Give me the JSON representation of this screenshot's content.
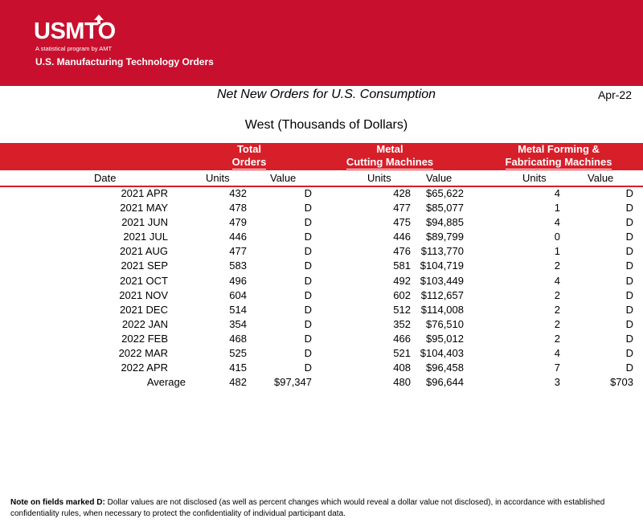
{
  "header": {
    "logo_text": "USMTO",
    "logo_subtitle": "A statistical program by AMT",
    "banner_title": "U.S. Manufacturing Technology Orders"
  },
  "title": "Net New Orders for U.S. Consumption",
  "period": "Apr-22",
  "subtitle": "West (Thousands of Dollars)",
  "groups": {
    "total": [
      "Total",
      "Orders"
    ],
    "metal_cutting": [
      "Metal",
      "Cutting Machines"
    ],
    "metal_forming": [
      "Metal Forming &",
      "Fabricating Machines"
    ]
  },
  "columns": {
    "date": "Date",
    "units": "Units",
    "value": "Value"
  },
  "rows": [
    {
      "date": "2021 APR",
      "total_units": "432",
      "total_value": "D",
      "mc_units": "428",
      "mc_value": "$65,622",
      "mf_units": "4",
      "mf_value": "D"
    },
    {
      "date": "2021 MAY",
      "total_units": "478",
      "total_value": "D",
      "mc_units": "477",
      "mc_value": "$85,077",
      "mf_units": "1",
      "mf_value": "D"
    },
    {
      "date": "2021 JUN",
      "total_units": "479",
      "total_value": "D",
      "mc_units": "475",
      "mc_value": "$94,885",
      "mf_units": "4",
      "mf_value": "D"
    },
    {
      "date": "2021 JUL",
      "total_units": "446",
      "total_value": "D",
      "mc_units": "446",
      "mc_value": "$89,799",
      "mf_units": "0",
      "mf_value": "D"
    },
    {
      "date": "2021 AUG",
      "total_units": "477",
      "total_value": "D",
      "mc_units": "476",
      "mc_value": "$113,770",
      "mf_units": "1",
      "mf_value": "D"
    },
    {
      "date": "2021 SEP",
      "total_units": "583",
      "total_value": "D",
      "mc_units": "581",
      "mc_value": "$104,719",
      "mf_units": "2",
      "mf_value": "D"
    },
    {
      "date": "2021 OCT",
      "total_units": "496",
      "total_value": "D",
      "mc_units": "492",
      "mc_value": "$103,449",
      "mf_units": "4",
      "mf_value": "D"
    },
    {
      "date": "2021 NOV",
      "total_units": "604",
      "total_value": "D",
      "mc_units": "602",
      "mc_value": "$112,657",
      "mf_units": "2",
      "mf_value": "D"
    },
    {
      "date": "2021 DEC",
      "total_units": "514",
      "total_value": "D",
      "mc_units": "512",
      "mc_value": "$114,008",
      "mf_units": "2",
      "mf_value": "D"
    },
    {
      "date": "2022 JAN",
      "total_units": "354",
      "total_value": "D",
      "mc_units": "352",
      "mc_value": "$76,510",
      "mf_units": "2",
      "mf_value": "D"
    },
    {
      "date": "2022 FEB",
      "total_units": "468",
      "total_value": "D",
      "mc_units": "466",
      "mc_value": "$95,012",
      "mf_units": "2",
      "mf_value": "D"
    },
    {
      "date": "2022 MAR",
      "total_units": "525",
      "total_value": "D",
      "mc_units": "521",
      "mc_value": "$104,403",
      "mf_units": "4",
      "mf_value": "D"
    },
    {
      "date": "2022 APR",
      "total_units": "415",
      "total_value": "D",
      "mc_units": "408",
      "mc_value": "$96,458",
      "mf_units": "7",
      "mf_value": "D"
    },
    {
      "date": "Average",
      "total_units": "482",
      "total_value": "$97,347",
      "mc_units": "480",
      "mc_value": "$96,644",
      "mf_units": "3",
      "mf_value": "$703"
    }
  ],
  "footnote": {
    "label": "Note on fields marked D:",
    "text": " Dollar values are not disclosed (as well as percent changes which would reveal a dollar value not disclosed), in accordance with established confidentiality rules, when necessary to protect the confidentiality of individual participant data."
  },
  "colors": {
    "banner": "#c8102e",
    "header_bar": "#d71f2a"
  }
}
